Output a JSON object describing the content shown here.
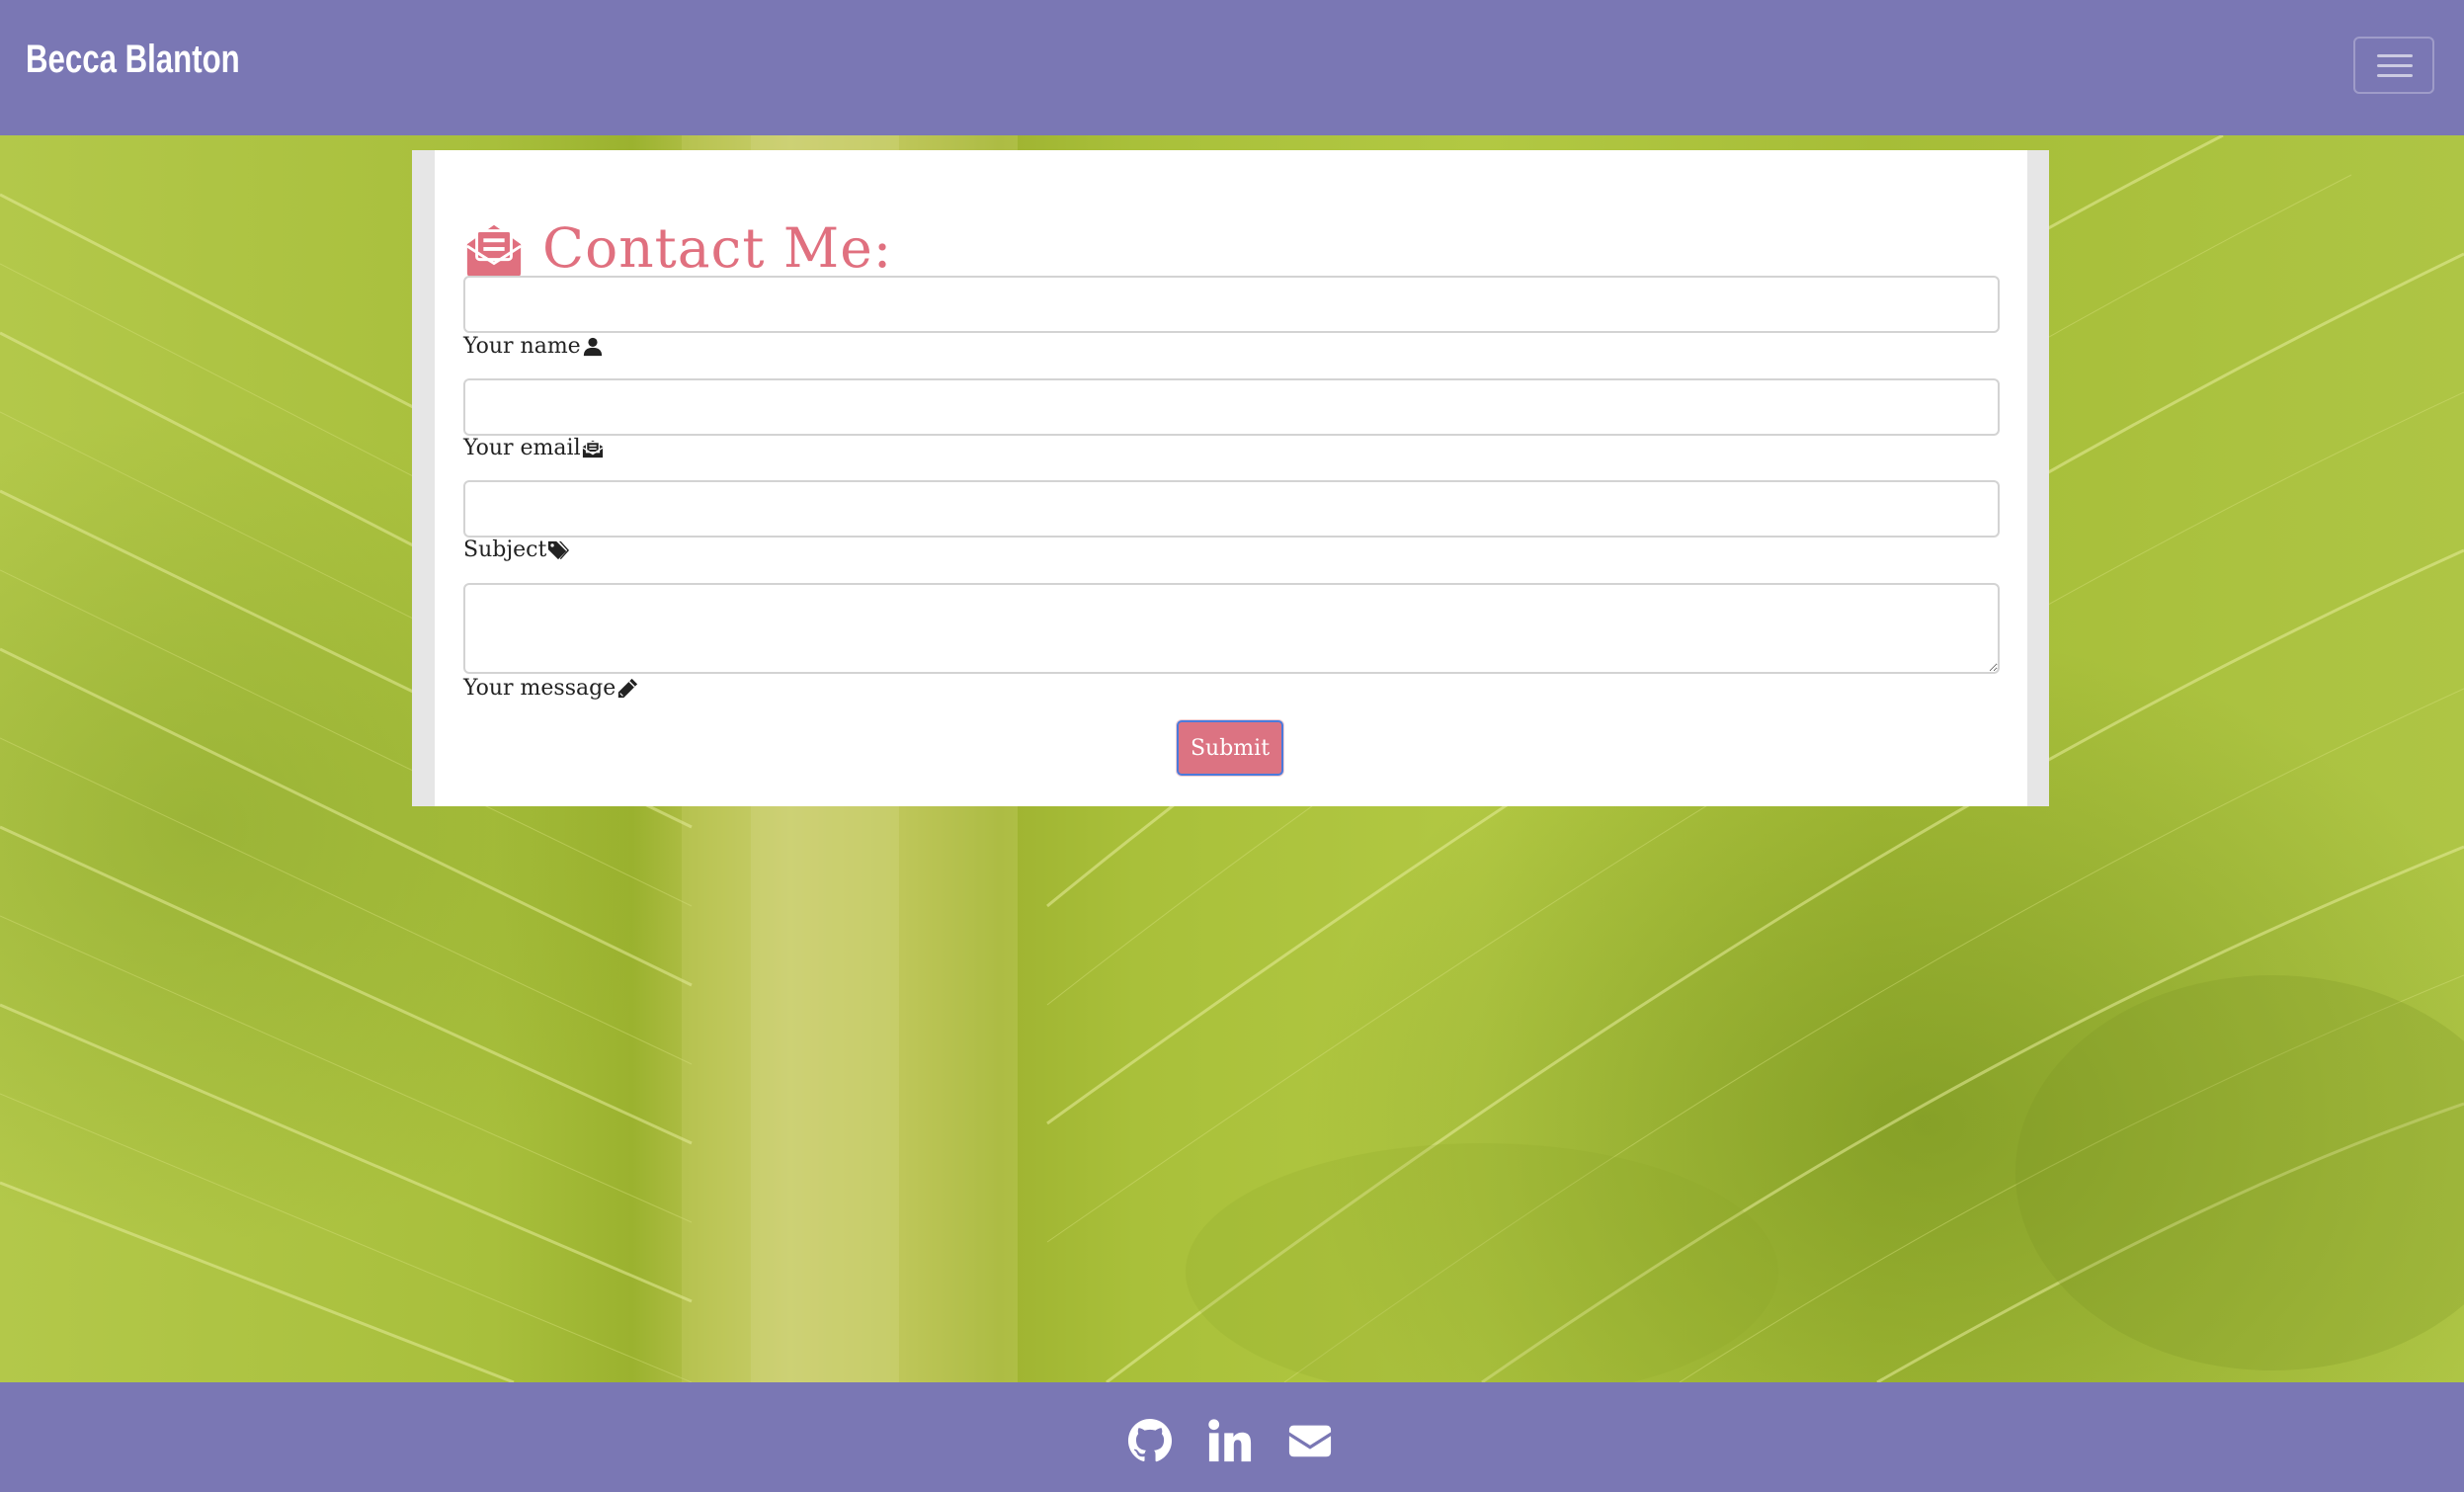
{
  "navbar": {
    "brand": "Becca Blanton",
    "toggle_icon": "hamburger-menu-icon"
  },
  "contact": {
    "title": "Contact Me:",
    "title_icon": "envelope-open-text-icon",
    "fields": [
      {
        "label": "Your name",
        "icon": "user-icon",
        "value": ""
      },
      {
        "label": "Your email",
        "icon": "envelope-open-text-icon",
        "value": ""
      },
      {
        "label": "Subject",
        "icon": "tags-icon",
        "value": ""
      },
      {
        "label": "Your message",
        "icon": "pencil-icon",
        "value": ""
      }
    ],
    "submit_label": "Submit"
  },
  "footer": {
    "links": [
      {
        "icon": "github-icon"
      },
      {
        "icon": "linkedin-icon"
      },
      {
        "icon": "envelope-icon"
      }
    ]
  },
  "colors": {
    "nav_footer_bg": "#7a77b4",
    "accent_pink": "#e0707f",
    "leaf_green": "#a9be3a",
    "card_bg": "#ffffff"
  }
}
